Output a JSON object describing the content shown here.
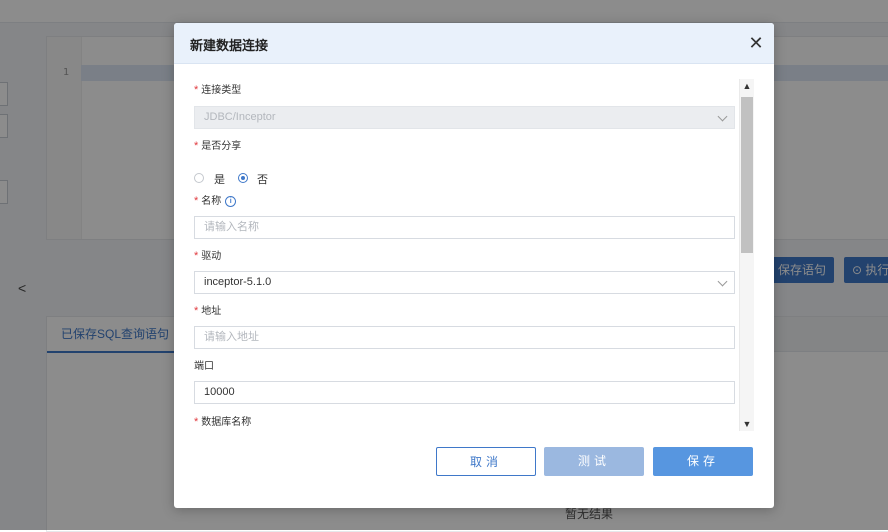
{
  "background": {
    "editor_line_number": "1",
    "buttons": {
      "save_statement": "保存语句",
      "execute": "⊙ 执行"
    },
    "tab_saved_sql": "已保存SQL查询语句",
    "no_result": "暂无结果",
    "left_arrow_icon": "chevron-left-icon"
  },
  "modal": {
    "title": "新建数据连接",
    "close_icon": "close-icon",
    "fields": {
      "connection_type": {
        "label": "连接类型",
        "value": "JDBC/Inceptor"
      },
      "share": {
        "label": "是否分享",
        "option_yes": "是",
        "option_no": "否",
        "selected": "否"
      },
      "name": {
        "label": "名称",
        "placeholder": "请输入名称"
      },
      "driver": {
        "label": "驱动",
        "value": "inceptor-5.1.0"
      },
      "address": {
        "label": "地址",
        "placeholder": "请输入地址"
      },
      "port": {
        "label": "端口",
        "value": "10000"
      },
      "database_name": {
        "label": "数据库名称"
      }
    },
    "buttons": {
      "cancel": "取消",
      "test": "测试",
      "save": "保存"
    }
  },
  "colors": {
    "accent": "#3f78c9",
    "required": "#e0393e",
    "header_bg": "#e9f1fb"
  }
}
